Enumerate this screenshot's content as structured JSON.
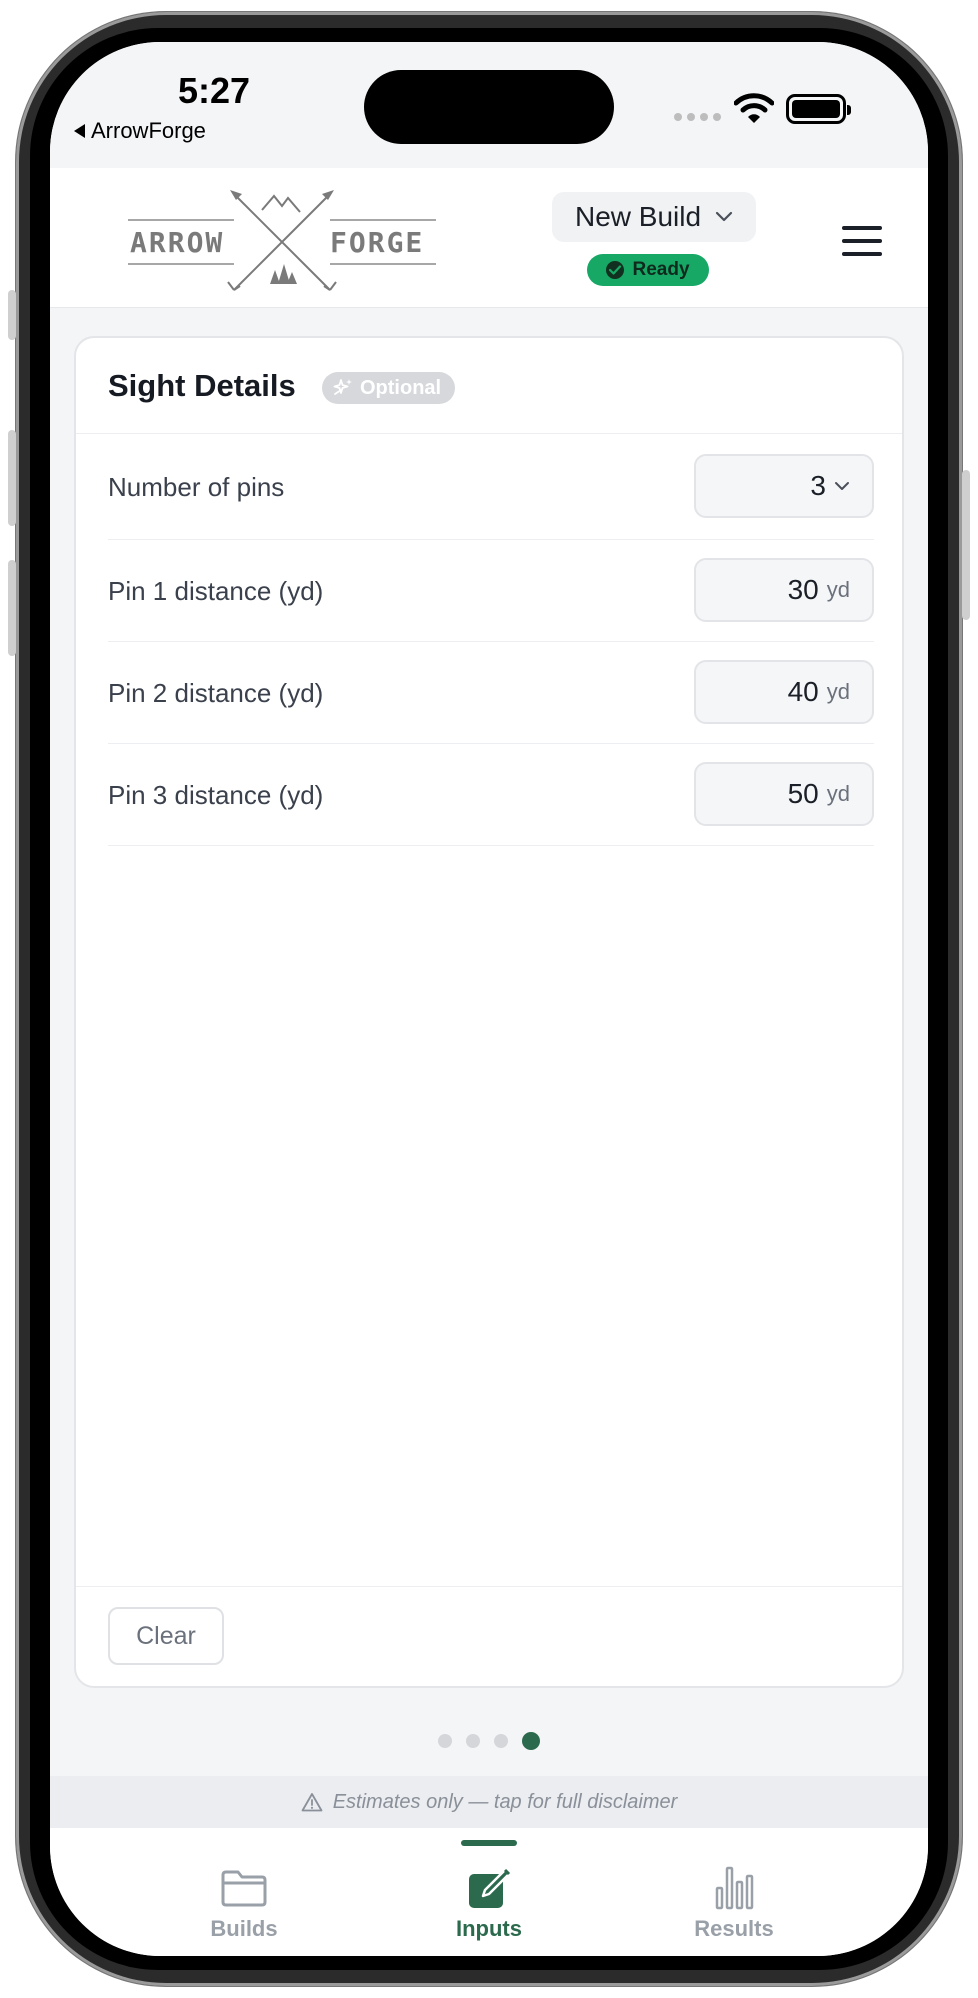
{
  "status_bar": {
    "time": "5:27",
    "back_label": "ArrowForge"
  },
  "header": {
    "logo_text_left": "ARROW",
    "logo_text_right": "FORGE",
    "build_selector_label": "New Build",
    "status_badge": "Ready",
    "menu_icon": "hamburger-icon"
  },
  "card": {
    "title": "Sight Details",
    "badge": "Optional",
    "fields": [
      {
        "label": "Number of pins",
        "value": "3",
        "unit": "",
        "type": "select"
      },
      {
        "label": "Pin 1 distance (yd)",
        "value": "30",
        "unit": "yd",
        "type": "number"
      },
      {
        "label": "Pin 2 distance (yd)",
        "value": "40",
        "unit": "yd",
        "type": "number"
      },
      {
        "label": "Pin 3 distance (yd)",
        "value": "50",
        "unit": "yd",
        "type": "number"
      }
    ],
    "clear_label": "Clear"
  },
  "pager": {
    "total": 4,
    "active": 4
  },
  "disclaimer": "Estimates only — tap for full disclaimer",
  "tabs": [
    {
      "label": "Builds",
      "icon": "folder-icon",
      "active": false
    },
    {
      "label": "Inputs",
      "icon": "edit-icon",
      "active": true
    },
    {
      "label": "Results",
      "icon": "bar-chart-icon",
      "active": false
    }
  ],
  "colors": {
    "accent": "#2b6a4d",
    "ready": "#17a866",
    "badge_gray": "#d6d8dc"
  }
}
